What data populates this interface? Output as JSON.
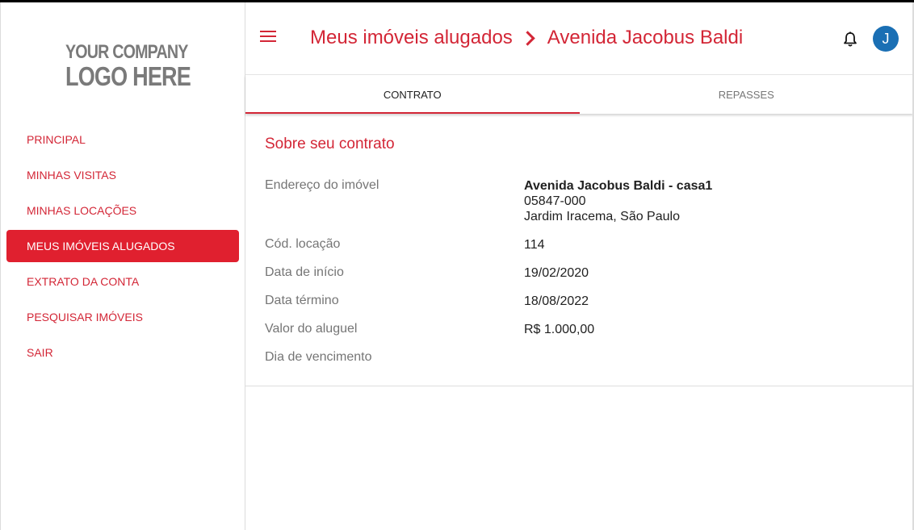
{
  "sidebar": {
    "logo_line1": "YOUR COMPANY",
    "logo_line2": "LOGO HERE",
    "items": [
      {
        "label": "PRINCIPAL"
      },
      {
        "label": "MINHAS VISITAS"
      },
      {
        "label": "MINHAS LOCAÇÕES"
      },
      {
        "label": "MEUS IMÓVEIS ALUGADOS",
        "active": true
      },
      {
        "label": "EXTRATO DA CONTA"
      },
      {
        "label": "PESQUISAR IMÓVEIS"
      },
      {
        "label": "SAIR"
      }
    ]
  },
  "header": {
    "menu_icon": "hamburger-menu-icon",
    "breadcrumb_parent": "Meus imóveis alugados",
    "breadcrumb_current": "Avenida Jacobus Baldi",
    "bell_icon": "bell-icon",
    "avatar_initial": "J",
    "colors": {
      "accent": "#d32636",
      "avatar": "#1a6fb4",
      "active_nav": "#e0202f"
    }
  },
  "tabs": [
    {
      "label": "CONTRATO",
      "active": true
    },
    {
      "label": "REPASSES",
      "active": false
    }
  ],
  "contract": {
    "title": "Sobre seu contrato",
    "address_label": "Endereço do imóvel",
    "address_line1": "Avenida Jacobus Baldi - casa1",
    "address_line2": "05847-000",
    "address_line3": "Jardim Iracema, São Paulo",
    "code_label": "Cód. locação",
    "code_value": "114",
    "start_label": "Data de início",
    "start_value": "19/02/2020",
    "end_label": "Data término",
    "end_value": "18/08/2022",
    "rent_label": "Valor do aluguel",
    "rent_value": "R$ 1.000,00",
    "due_label": "Dia de vencimento",
    "due_value": ""
  }
}
